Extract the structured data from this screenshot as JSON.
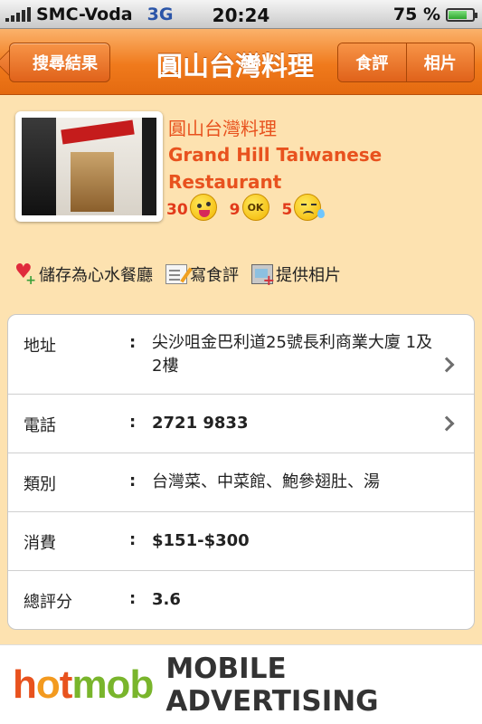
{
  "status_bar": {
    "carrier": "SMC-Voda",
    "network": "3G",
    "time": "20:24",
    "battery": "75 %",
    "battery_level_percent": 75
  },
  "nav": {
    "back_label": "搜尋結果",
    "title": "圓山台灣料理",
    "segments": [
      "食評",
      "相片"
    ]
  },
  "restaurant": {
    "name_zh": "圓山台灣料理",
    "name_en": "Grand Hill Taiwanese Restaurant",
    "ratings": {
      "good": "30",
      "ok": "9",
      "bad": "5",
      "ok_face_text": "OK"
    }
  },
  "actions": {
    "save": "儲存為心水餐廳",
    "review": "寫食評",
    "photo": "提供相片"
  },
  "info": {
    "address": {
      "label": "地址",
      "colon": ":",
      "value": "尖沙咀金巴利道25號長利商業大廈 1及2樓"
    },
    "phone": {
      "label": "電話",
      "colon": ":",
      "value": "2721 9833"
    },
    "category": {
      "label": "類別",
      "colon": ":",
      "value": "台灣菜、中菜館、鮑參翅肚、湯"
    },
    "price": {
      "label": "消費",
      "colon": ":",
      "value": "$151-$300"
    },
    "score": {
      "label": "總評分",
      "colon": ":",
      "value": "3.6"
    }
  },
  "ad": {
    "logo_parts": [
      "h",
      "o",
      "t",
      "mob"
    ],
    "text": "MOBILE ADVERTISING"
  }
}
